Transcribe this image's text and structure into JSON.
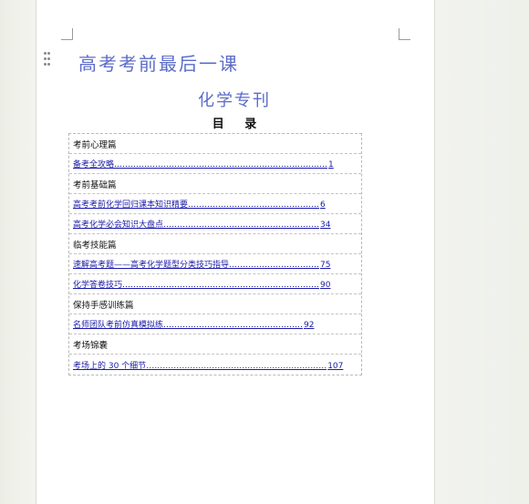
{
  "document": {
    "title_main": "高考考前最后一课",
    "title_sub": "化学专刊",
    "toc_heading": "目 录"
  },
  "toc": {
    "rows": [
      {
        "type": "section",
        "text": "考前心理篇"
      },
      {
        "type": "entry",
        "text": "备考全攻略",
        "dots": "……………………………………………………………………",
        "page": "1"
      },
      {
        "type": "section",
        "text": "考前基础篇"
      },
      {
        "type": "entry",
        "text": "高考考前化学回归课本知识精要",
        "dots": "…………………………………………",
        "page": "6"
      },
      {
        "type": "entry",
        "text": "高考化学必会知识大盘点",
        "dots": "…………………………………………………",
        "page": "34"
      },
      {
        "type": "section",
        "text": "临考技能篇"
      },
      {
        "type": "entry",
        "text": "速解高考题——高考化学题型分类技巧指导",
        "dots": "……………………………",
        "page": "75"
      },
      {
        "type": "entry",
        "text": "化学答卷技巧",
        "dots": "………………………………………………………………",
        "page": "90"
      },
      {
        "type": "section",
        "text": "保持手感训练篇"
      },
      {
        "type": "entry",
        "text": "名师团队考前仿真模拟练",
        "dots": "……………………………………………",
        "page": "92"
      },
      {
        "type": "section",
        "text": "考场锦囊"
      },
      {
        "type": "entry",
        "text": "考场上的 30 个细节",
        "dots": "…………………………………………………………",
        "page": "107"
      }
    ]
  }
}
